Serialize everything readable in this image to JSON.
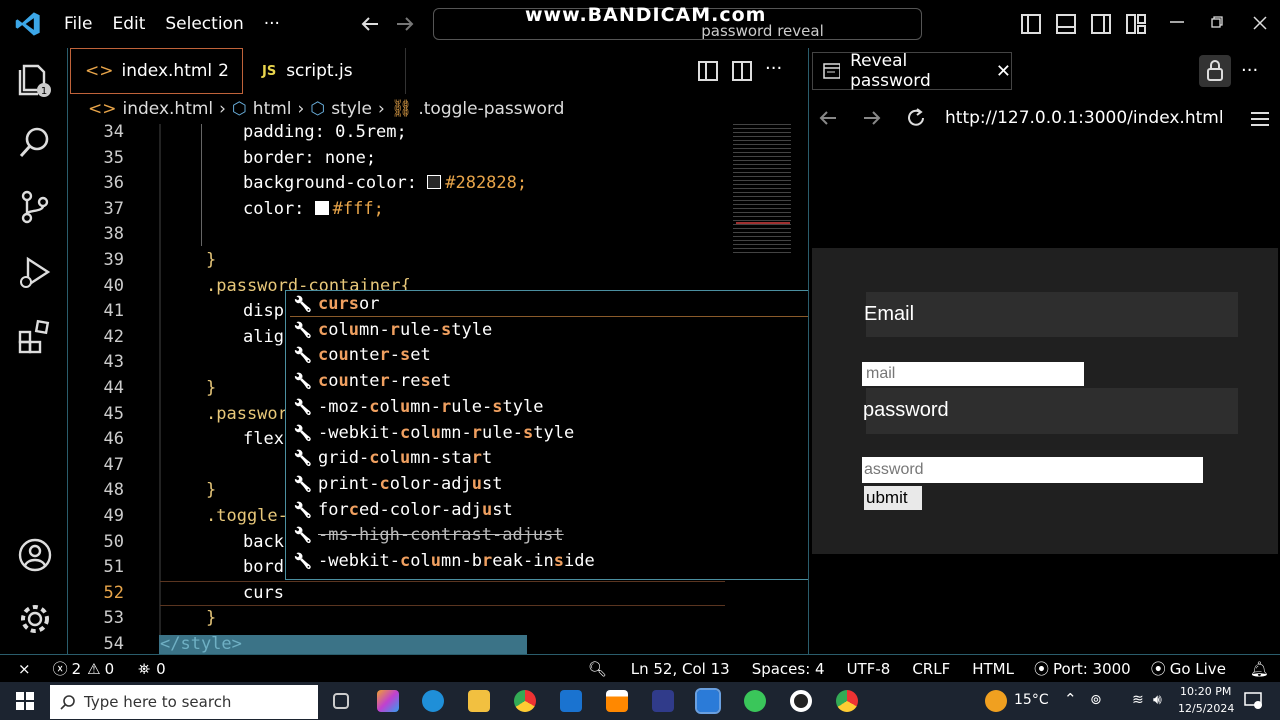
{
  "titlebar": {
    "menus": [
      "File",
      "Edit",
      "Selection",
      "···"
    ],
    "search_text": "password reveal",
    "watermark": "www.BANDICAM.com"
  },
  "tabs": [
    {
      "label": "index.html",
      "badge": "2",
      "prefix": "<>"
    },
    {
      "label": "script.js",
      "prefix": "JS"
    }
  ],
  "breadcrumb": [
    "index.html",
    "html",
    "style",
    ".toggle-password"
  ],
  "editor": {
    "lines": [
      {
        "n": "34",
        "text": "padding: 0.5rem;"
      },
      {
        "n": "35",
        "text": "border: none;"
      },
      {
        "n": "36",
        "text": "background-color: ",
        "value": "#282828;"
      },
      {
        "n": "37",
        "text": "color: ",
        "value": "#fff;"
      },
      {
        "n": "38",
        "text": ""
      },
      {
        "n": "39",
        "text": "}"
      },
      {
        "n": "40",
        "text": ".password-container{"
      },
      {
        "n": "41",
        "text": "disp"
      },
      {
        "n": "42",
        "text": "alig"
      },
      {
        "n": "43",
        "text": ""
      },
      {
        "n": "44",
        "text": "}"
      },
      {
        "n": "45",
        "text": ".passwor"
      },
      {
        "n": "46",
        "text": "flex"
      },
      {
        "n": "47",
        "text": ""
      },
      {
        "n": "48",
        "text": "}"
      },
      {
        "n": "49",
        "text": ".toggle-"
      },
      {
        "n": "50",
        "text": "back"
      },
      {
        "n": "51",
        "text": "bord"
      },
      {
        "n": "52",
        "text": "curs"
      },
      {
        "n": "53",
        "text": "}"
      },
      {
        "n": "54",
        "text": "</style>"
      }
    ]
  },
  "suggestions": [
    "cursor",
    "column-rule-style",
    "counter-set",
    "counter-reset",
    "-moz-column-rule-style",
    "-webkit-column-rule-style",
    "grid-column-start",
    "print-color-adjust",
    "forced-color-adjust",
    "-ms-high-contrast-adjust",
    "-webkit-column-break-inside"
  ],
  "browser": {
    "tab_label": "Reveal password",
    "url": "http://127.0.0.1:3000/index.html",
    "email_label": "Email",
    "email_placeholder": "mail",
    "password_label": "password",
    "password_placeholder": "assword",
    "submit_label": "ubmit"
  },
  "status": {
    "errors": "2",
    "warnings": "0",
    "ports": "0",
    "position": "Ln 52, Col 13",
    "spaces": "Spaces: 4",
    "encoding": "UTF-8",
    "eol": "CRLF",
    "language": "HTML",
    "port": "Port: 3000",
    "golive": "Go Live"
  },
  "taskbar": {
    "search_placeholder": "Type here to search",
    "temperature": "15°C",
    "time": "10:20 PM",
    "date": "12/5/2024"
  },
  "colors": {
    "accent": "#2a5d6c",
    "tab_border": "#c0633a",
    "suggest_border": "#4b8fa0",
    "highlight": "#f0a060"
  }
}
